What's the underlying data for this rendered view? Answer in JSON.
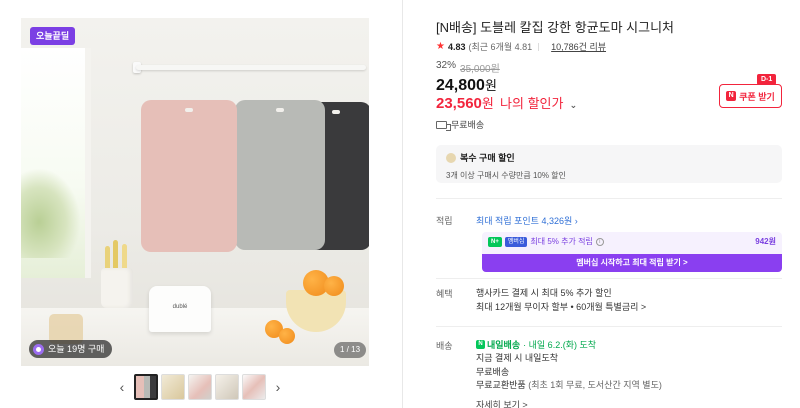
{
  "gallery": {
    "badge": "오늘끝딜",
    "buying_now": "오늘 19명 구매",
    "image_counter": "1 / 13",
    "product_logo": "dublé",
    "prev_icon": "chevron-left-icon",
    "next_icon": "chevron-right-icon",
    "thumbnails": [
      {
        "active": true
      },
      {
        "active": false
      },
      {
        "active": false
      },
      {
        "active": false
      },
      {
        "active": false
      }
    ]
  },
  "product": {
    "title": "[N배송] 도블레 칼집 강한 항균도마 시그니처",
    "rating": "4.83",
    "recent_rating": "(최근 6개월 4.81",
    "reviews": "10,786건 리뷰",
    "discount": "32%",
    "original_price": "35,000원",
    "price_number": "24,800",
    "price_unit": "원",
    "my_price_number": "23,560",
    "my_price_unit": "원",
    "my_price_label": "나의 할인가",
    "shipping": "무료배송"
  },
  "coupon": {
    "dday": "D-1",
    "label": "쿠폰 받기"
  },
  "multi_purchase": {
    "title": "복수 구매 할인",
    "desc": "3개 이상 구매시 수량만큼 10% 할인"
  },
  "points": {
    "label": "적립",
    "max_text": "최대 적립 포인트 4,326원",
    "member_text": "최대 5% 추가 적립",
    "member_amount": "942원",
    "member_cta": "멤버십 시작하고 최대 적립 받기 >",
    "np_badge": "N+",
    "mem_badge": "멤버십"
  },
  "benefits": {
    "label": "혜택",
    "line1": "행사카드 결제 시 최대 5% 추가 할인",
    "line2": "최대 12개월 무이자 할부 • 60개월 특별금리 >"
  },
  "delivery": {
    "label": "배송",
    "brand": "내일배송",
    "eta": "· 내일 6.2.(화) 도착",
    "line1": "지금 결제 시 내일도착",
    "line2": "무료배송",
    "line3": "무료교환반품",
    "line3_sub": "(최초 1회 무료, 도서산간 지역 별도)",
    "more": "자세히 보기 >"
  },
  "colors": {
    "accent_red": "#f2243c",
    "naver_green": "#03c75a",
    "membership_purple": "#8a3ff0",
    "points_blue": "#2f6fd6"
  }
}
